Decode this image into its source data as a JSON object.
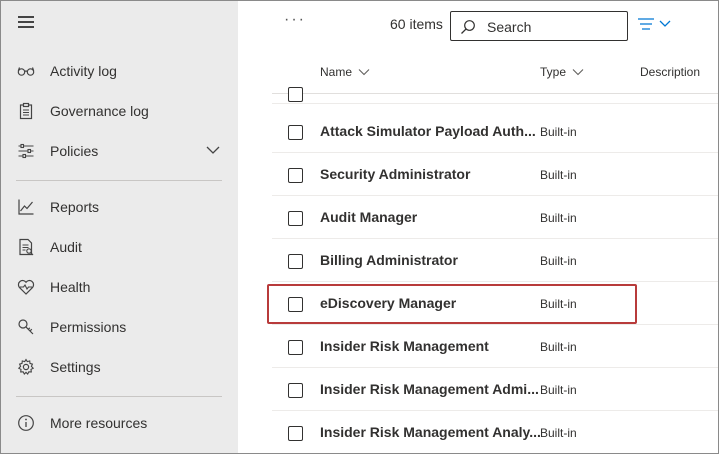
{
  "sidebar": {
    "items": [
      {
        "label": "Activity log",
        "icon": "glasses-icon"
      },
      {
        "label": "Governance log",
        "icon": "clipboard-icon"
      },
      {
        "label": "Policies",
        "icon": "sliders-icon"
      },
      {
        "label": "Reports",
        "icon": "line-chart-icon"
      },
      {
        "label": "Audit",
        "icon": "audit-document-icon"
      },
      {
        "label": "Health",
        "icon": "heart-pulse-icon"
      },
      {
        "label": "Permissions",
        "icon": "key-icon"
      },
      {
        "label": "Settings",
        "icon": "gear-icon"
      },
      {
        "label": "More resources",
        "icon": "info-icon"
      }
    ]
  },
  "toolbar": {
    "more_label": "···",
    "count_label": "60 items",
    "search_placeholder": "Search"
  },
  "table": {
    "columns": [
      "Name",
      "Type",
      "Description"
    ],
    "rows": [
      {
        "name": "Attack Simulator Payload Auth...",
        "type": "Built-in"
      },
      {
        "name": "Security Administrator",
        "type": "Built-in"
      },
      {
        "name": "Audit Manager",
        "type": "Built-in"
      },
      {
        "name": "Billing Administrator",
        "type": "Built-in"
      },
      {
        "name": "eDiscovery Manager",
        "type": "Built-in"
      },
      {
        "name": "Insider Risk Management",
        "type": "Built-in"
      },
      {
        "name": "Insider Risk Management Admi...",
        "type": "Built-in"
      },
      {
        "name": "Insider Risk Management Analy...",
        "type": "Built-in"
      }
    ]
  },
  "colors": {
    "sidebar_bg": "#ebebeb",
    "highlight": "#b83b3b",
    "text": "#323130",
    "accent": "#0078d4"
  }
}
